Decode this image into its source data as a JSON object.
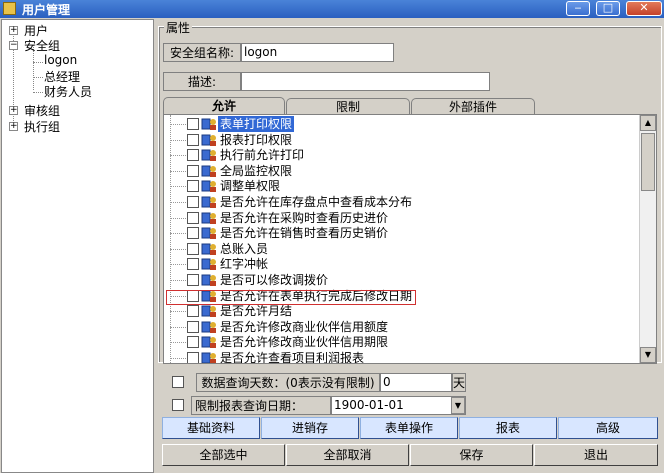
{
  "window": {
    "title": "用户管理",
    "minimize": "‒",
    "maximize": "□",
    "close": "✕"
  },
  "tree": {
    "nodes": [
      {
        "label": "用户",
        "expander": "+"
      },
      {
        "label": "安全组",
        "expander": "−"
      },
      {
        "label": "logon"
      },
      {
        "label": "总经理"
      },
      {
        "label": "财务人员"
      },
      {
        "label": "审核组",
        "expander": "+"
      },
      {
        "label": "执行组",
        "expander": "+"
      }
    ]
  },
  "properties": {
    "legend": "属性",
    "group_name_label": "安全组名称:",
    "group_name_value": "logon",
    "desc_label": "描述:",
    "desc_value": ""
  },
  "tabs": [
    "允许",
    "限制",
    "外部插件"
  ],
  "permissions": [
    "表单打印权限",
    "报表打印权限",
    "执行前允许打印",
    "全局监控权限",
    "调整单权限",
    "是否允许在库存盘点中查看成本分布",
    "是否允许在采购时查看历史进价",
    "是否允许在销售时查看历史销价",
    "总账入员",
    "红字冲帐",
    "是否可以修改调拨价",
    "是否允许在表单执行完成后修改日期",
    "是否允许月结",
    "是否允许修改商业伙伴信用额度",
    "是否允许修改商业伙伴信用期限",
    "是否允许查看项目利润报表"
  ],
  "query_days": {
    "label": "数据查询天数：(0表示没有限制)",
    "value": "0",
    "unit": "天"
  },
  "report_date": {
    "label": "限制报表查询日期：",
    "value": "1900-01-01"
  },
  "categories": [
    "基础资料",
    "进销存",
    "表单操作",
    "报表",
    "高级"
  ],
  "actions": [
    "全部选中",
    "全部取消",
    "保存",
    "退出"
  ]
}
